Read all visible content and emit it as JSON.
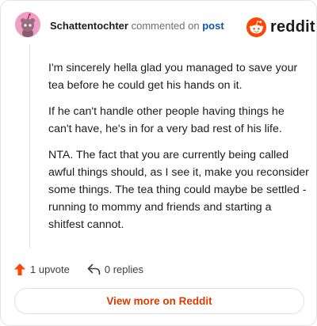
{
  "header": {
    "username": "Schattentochter",
    "action_text": "commented on",
    "target_link": "post"
  },
  "brand": {
    "icon": "reddit-snoo-icon",
    "wordmark": "reddit",
    "color": "#ff4500"
  },
  "comment": {
    "paragraphs": [
      "I'm sincerely hella glad you managed to save your tea before he could get his hands on it.",
      "If he can't handle other people having things he can't have, he's in for a very bad rest of his life.",
      "NTA. The fact that you are currently being called awful things should, as I see it, make you reconsider some things. The tea thing could maybe be settled - running to mommy and friends and starting a shitfest cannot."
    ]
  },
  "actions": {
    "upvote_label": "1 upvote",
    "upvote_icon": "upvote-arrow-icon",
    "upvote_color": "#ff4500",
    "replies_label": "0 replies",
    "replies_icon": "reply-arrow-icon"
  },
  "footer": {
    "view_more_label": "View more on Reddit",
    "view_more_color": "#d93a00"
  }
}
